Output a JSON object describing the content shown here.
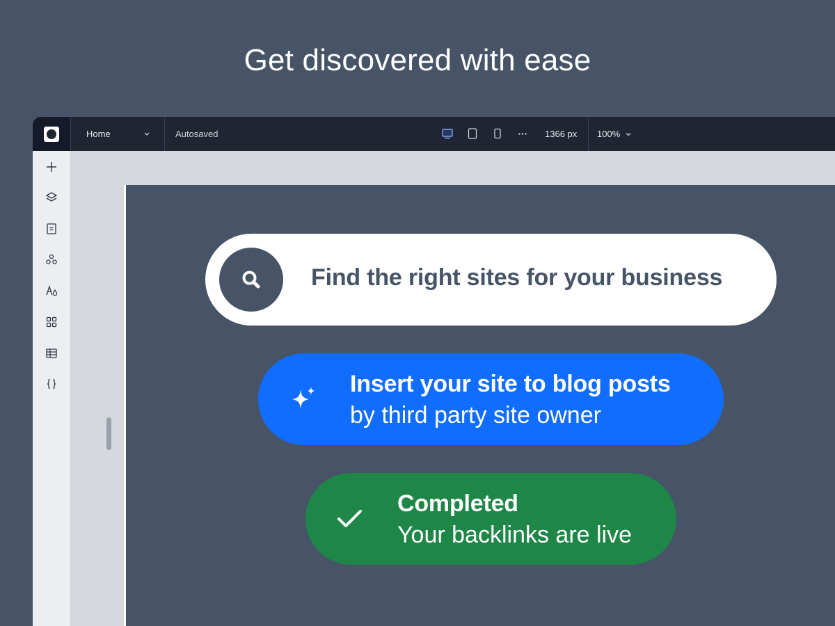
{
  "headline": "Get discovered with ease",
  "editor": {
    "page_select": "Home",
    "status": "Autosaved",
    "canvas_width": "1366 px",
    "zoom": "100%",
    "device_icons": [
      "desktop-icon",
      "tablet-icon",
      "mobile-icon",
      "more-icon"
    ],
    "sidebar_icons": [
      "add-icon",
      "layers-icon",
      "pages-icon",
      "apps-icon",
      "theme-icon",
      "widgets-icon",
      "table-icon",
      "code-icon"
    ]
  },
  "cards": {
    "find": {
      "text": "Find the right sites for your business",
      "icon": "search-icon"
    },
    "insert": {
      "title": "Insert your site to blog posts",
      "subtitle": "by third party site owner",
      "icon": "sparkle-icon"
    },
    "completed": {
      "title": "Completed",
      "subtitle": "Your backlinks are live",
      "icon": "check-icon"
    }
  },
  "colors": {
    "background": "#475467",
    "find_card": "#ffffff",
    "insert_card": "#116dff",
    "completed_card": "#1e8647",
    "topbar": "#1f2531"
  }
}
